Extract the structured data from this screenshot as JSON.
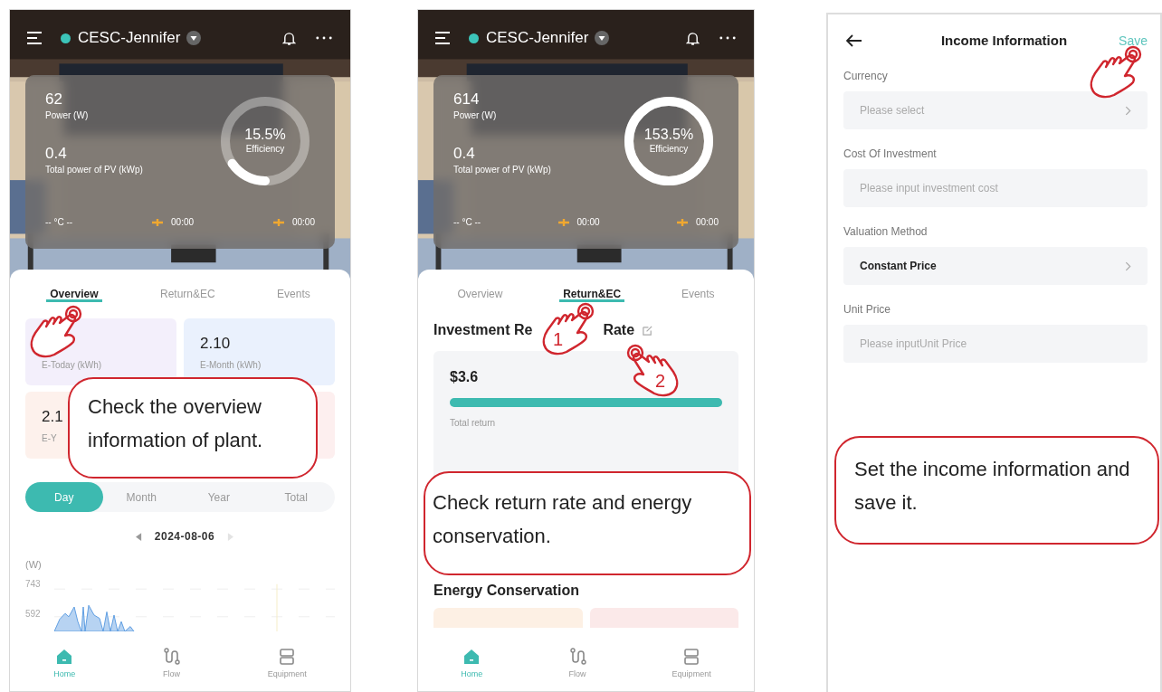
{
  "screens": [
    {
      "kind": "overview",
      "plant": "CESC-Jennifer",
      "hand": true,
      "summary": {
        "power": "62",
        "power_label": "Power (W)",
        "pv": "0.4",
        "pv_label": "Total power of PV (kWp)",
        "efficiency": "15.5%",
        "efficiency_label": "Efficiency",
        "level": 0.155,
        "temp": "-- °C --",
        "sunrise": "00:00",
        "sunset": "00:00"
      },
      "tabs": [
        {
          "label": "Overview",
          "selected": true
        },
        {
          "label": "Return&EC",
          "selected": false
        },
        {
          "label": "Events",
          "selected": false
        }
      ],
      "tiles": [
        {
          "label": "E-Today (kWh)",
          "color": "#f3effb"
        },
        {
          "value": "2.10",
          "label": "E-Month (kWh)",
          "color": "#eaf1fd"
        },
        {
          "value": "2.1",
          "label": "E-Y",
          "color": "#fdf1ec"
        },
        {
          "color": "#fdefef"
        }
      ],
      "periods": [
        {
          "label": "Day",
          "selected": true
        },
        {
          "label": "Month",
          "selected": false
        },
        {
          "label": "Year",
          "selected": false
        },
        {
          "label": "Total",
          "selected": false
        }
      ],
      "date": "2024-08-06",
      "chart": {
        "unit": "(W)",
        "ticks": [
          "743",
          "592"
        ]
      },
      "nav": [
        {
          "label": "Home",
          "selected": true
        },
        {
          "label": "Flow",
          "selected": false
        },
        {
          "label": "Equipment",
          "selected": false
        }
      ],
      "callout": "Check the overview information of plant."
    },
    {
      "kind": "returns",
      "plant": "CESC-Jennifer",
      "summary": {
        "power": "614",
        "power_label": "Power (W)",
        "pv": "0.4",
        "pv_label": "Total power of PV (kWp)",
        "efficiency": "153.5%",
        "efficiency_label": "Efficiency",
        "level": 1,
        "temp": "-- °C --",
        "sunrise": "00:00",
        "sunset": "00:00"
      },
      "tabs": [
        {
          "label": "Overview",
          "selected": false
        },
        {
          "label": "Return&EC",
          "selected": true
        },
        {
          "label": "Events",
          "selected": false
        }
      ],
      "section_title": "Investment Re",
      "section_title_end": "Rate",
      "return": {
        "amount": "$3.6",
        "level": 1,
        "label": "Total return"
      },
      "section_title_2": "Energy Conservation",
      "ec_tiles": [
        {
          "color": "#fdf0e4"
        },
        {
          "color": "#fbe9e9"
        }
      ],
      "nav": [
        {
          "label": "Home",
          "selected": true
        },
        {
          "label": "Flow",
          "selected": false
        },
        {
          "label": "Equipment",
          "selected": false
        }
      ],
      "hand_numbers": [
        "1",
        "2"
      ],
      "callout": "Check return rate and energy conservation."
    },
    {
      "kind": "form",
      "title": "Income Information",
      "action": "Save",
      "fields": [
        {
          "label": "Currency",
          "kind": "select",
          "placeholder": "Please select"
        },
        {
          "label": "Cost Of Investment",
          "kind": "input",
          "placeholder": "Please input investment cost"
        },
        {
          "label": "Valuation Method",
          "kind": "select",
          "value": "Constant Price"
        },
        {
          "label": "Unit Price",
          "kind": "input",
          "placeholder": "Please inputUnit Price"
        }
      ],
      "hand": true,
      "callout": "Set the income information and save it."
    }
  ]
}
